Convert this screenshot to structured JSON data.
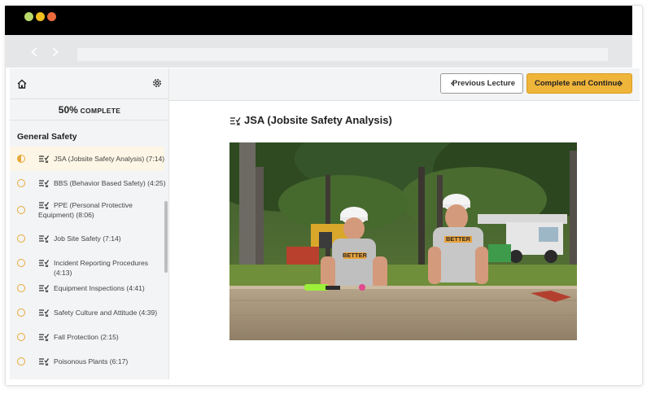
{
  "window": {
    "controls": [
      "green",
      "yellow",
      "red"
    ]
  },
  "sidebar": {
    "home_icon": "home-icon",
    "settings_icon": "gear-icon",
    "progress_percent": "50%",
    "progress_label": "COMPLETE",
    "section_title": "General Safety",
    "lessons": [
      {
        "label": "JSA (Jobsite Safety Analysis) (7:14)",
        "status": "in-progress"
      },
      {
        "label": "BBS (Behavior Based Safety) (4:25)",
        "status": "not-started"
      },
      {
        "label": "PPE (Personal Protective Equipment) (8:06)",
        "status": "not-started"
      },
      {
        "label": "Job Site Safety (7:14)",
        "status": "not-started"
      },
      {
        "label": "Incident Reporting Procedures (4:13)",
        "status": "not-started"
      },
      {
        "label": "Equipment Inspections (4:41)",
        "status": "not-started"
      },
      {
        "label": "Safety Culture and Attitude (4:39)",
        "status": "not-started"
      },
      {
        "label": "Fall Protection (2:15)",
        "status": "not-started"
      },
      {
        "label": "Poisonous Plants (6:17)",
        "status": "not-started"
      }
    ]
  },
  "toolbar": {
    "prev_label": "Previous Lecture",
    "next_label": "Complete and Continue"
  },
  "lecture": {
    "title": "JSA (Jobsite Safety Analysis)",
    "shirt_text": "BETTER"
  },
  "colors": {
    "accent": "#efb43a",
    "status_circle": "#e8a93a"
  }
}
